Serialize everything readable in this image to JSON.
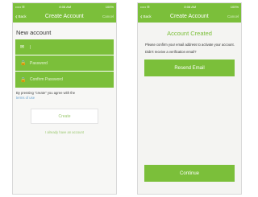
{
  "create_account_screen": {
    "status": {
      "carrier": "••••• ☰",
      "time": "8:08 AM",
      "battery": "100%"
    },
    "nav": {
      "back": "Back",
      "title": "Create Account",
      "cancel": "Cancel"
    },
    "section_title": "New account",
    "fields": [
      {
        "icon": "mail-icon",
        "value": "|"
      },
      {
        "icon": "lock-icon",
        "value": "Password"
      },
      {
        "icon": "lock-icon",
        "value": "Confirm Password"
      }
    ],
    "legal_text": "By pressing \"create\" you agree with the",
    "legal_link": "terms of use",
    "create_button": "Create",
    "have_account_link": "I already have an account"
  },
  "account_created_screen": {
    "status": {
      "carrier": "••••• ☰",
      "time": "8:08 AM",
      "battery": "100%"
    },
    "nav": {
      "back": "Back",
      "title": "Create Account",
      "cancel": "Cancel"
    },
    "title": "Account Created",
    "confirm_text": "Please confirm your email address to activate your account.",
    "no_email_text": "Didn't receive a verification email?",
    "resend_button": "Resend Email",
    "continue_button": "Continue"
  },
  "colors": {
    "accent": "#7bbf3a",
    "link": "#6aa3cf"
  }
}
